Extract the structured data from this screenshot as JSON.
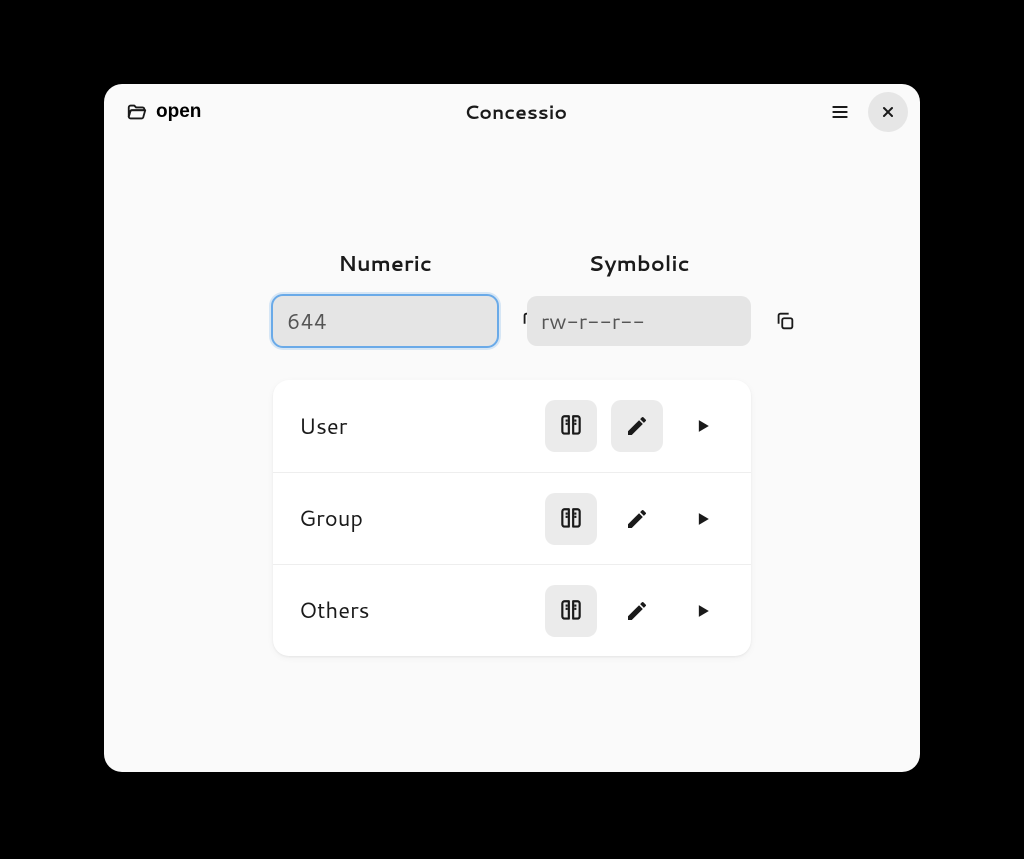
{
  "header": {
    "open_label": "open",
    "title": "Concessio"
  },
  "fields": {
    "numeric": {
      "label": "Numeric",
      "value": "644"
    },
    "symbolic": {
      "label": "Symbolic",
      "value": "rw-r--r--"
    }
  },
  "perms": [
    {
      "label": "User",
      "read": true,
      "write": true,
      "execute": false
    },
    {
      "label": "Group",
      "read": true,
      "write": false,
      "execute": false
    },
    {
      "label": "Others",
      "read": true,
      "write": false,
      "execute": false
    }
  ]
}
